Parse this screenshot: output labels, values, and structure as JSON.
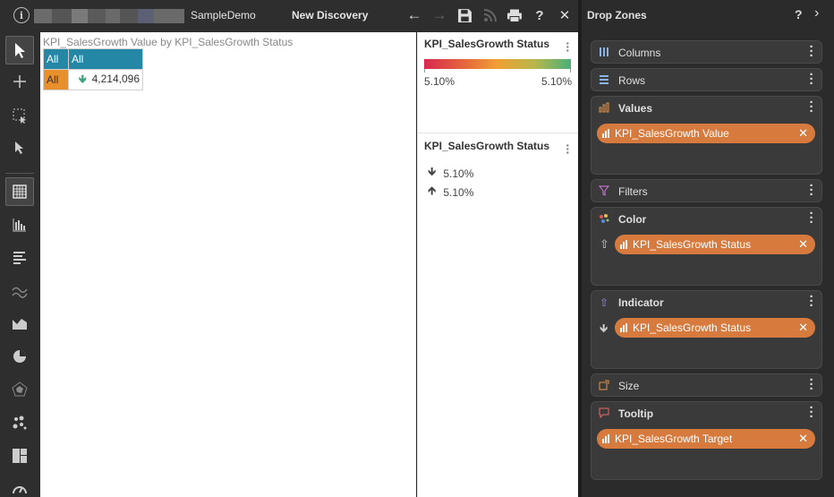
{
  "topbar": {
    "breadcrumb": "SampleDemo",
    "title": "New Discovery",
    "blur_colors": [
      "#6b6b6b",
      "#555",
      "#7a7a7a",
      "#5a5a5a",
      "#6a6a6a",
      "#555",
      "#5d5f75",
      "#6a6a6a"
    ]
  },
  "toolbar": {
    "info_label": "i",
    "back_label": "←",
    "forward_label": "→",
    "help_label": "?",
    "close_label": "✕"
  },
  "canvas": {
    "grid_title": "KPI_SalesGrowth Value by KPI_SalesGrowth Status",
    "header_cells": [
      "All",
      "All"
    ],
    "row_header": "All",
    "row_value": "4,214,096",
    "row_arrow": "🡻"
  },
  "legend": {
    "color_title": "KPI_SalesGrowth Status",
    "min_label": "5.10%",
    "max_label": "5.10%",
    "indicator_title": "KPI_SalesGrowth Status",
    "indicator_items": [
      {
        "arrow": "🡻",
        "label": "5.10%"
      },
      {
        "arrow": "🡹",
        "label": "5.10%"
      }
    ]
  },
  "dropzones": {
    "header": "Drop Zones",
    "help": "?",
    "chevron": "›",
    "zones": {
      "columns": {
        "label": "Columns"
      },
      "rows": {
        "label": "Rows"
      },
      "values": {
        "label": "Values",
        "pill": "KPI_SalesGrowth Value"
      },
      "filters": {
        "label": "Filters"
      },
      "color": {
        "label": "Color",
        "pill": "KPI_SalesGrowth Status"
      },
      "indicator": {
        "label": "Indicator",
        "pill": "KPI_SalesGrowth Status"
      },
      "size": {
        "label": "Size"
      },
      "tooltip": {
        "label": "Tooltip",
        "pill": "KPI_SalesGrowth Target"
      }
    }
  },
  "colors": {
    "accent_header": "#2487a5",
    "accent_orange": "#e8902c",
    "pill": "#d77a3e",
    "up_arrow_green": "#3aa37a"
  }
}
